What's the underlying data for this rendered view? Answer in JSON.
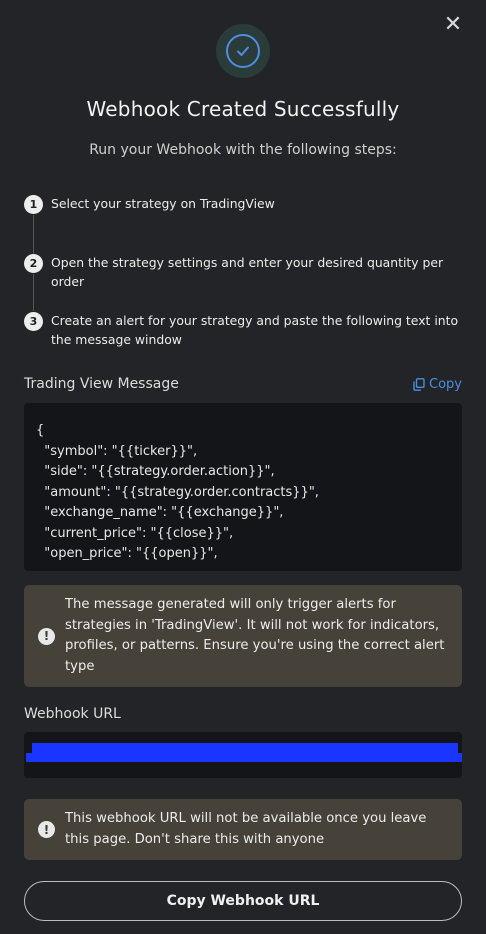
{
  "header": {
    "title": "Webhook Created Successfully",
    "subtitle": "Run your Webhook with the following steps:",
    "close_icon": "close-icon",
    "success_icon": "check-circle-icon"
  },
  "steps": [
    {
      "number": "1",
      "text": "Select your strategy on TradingView"
    },
    {
      "number": "2",
      "text": "Open the strategy settings and enter your desired quantity per order"
    },
    {
      "number": "3",
      "text": "Create an alert for your strategy and paste the following text into the message window"
    }
  ],
  "message": {
    "label": "Trading View Message",
    "copy_label": "Copy",
    "code": "{\n  \"symbol\": \"{{ticker}}\",\n  \"side\": \"{{strategy.order.action}}\",\n  \"amount\": \"{{strategy.order.contracts}}\",\n  \"exchange_name\": \"{{exchange}}\",\n  \"current_price\": \"{{close}}\",\n  \"open_price\": \"{{open}}\","
  },
  "alerts": {
    "trading_view": "The message generated will only trigger alerts for strategies in 'TradingView'. It will not work for indicators, profiles, or patterns. Ensure you're using the correct alert type",
    "url_warning": "This webhook URL will not be available once you leave this page. Don't share this with anyone"
  },
  "webhook": {
    "label": "Webhook URL"
  },
  "actions": {
    "copy_url": "Copy Webhook URL"
  },
  "colors": {
    "background": "#232427",
    "accent": "#4a8fe0",
    "notice_bg": "#46423a",
    "redaction": "#1a35ff"
  }
}
